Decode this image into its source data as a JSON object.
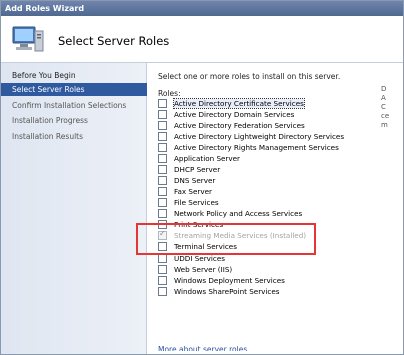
{
  "window": {
    "title": "Add Roles Wizard"
  },
  "header": {
    "title": "Select Server Roles",
    "icon": "server-computer-icon"
  },
  "sidebar": {
    "items": [
      {
        "label": "Before You Begin",
        "state": "normal"
      },
      {
        "label": "Select Server Roles",
        "state": "active"
      },
      {
        "label": "Confirm Installation Selections",
        "state": "inactive"
      },
      {
        "label": "Installation Progress",
        "state": "inactive"
      },
      {
        "label": "Installation Results",
        "state": "inactive"
      }
    ]
  },
  "main": {
    "instruction": "Select one or more roles to install on this server.",
    "roles_label": "Roles:",
    "roles": [
      {
        "label": "Active Directory Certificate Services",
        "checked": false,
        "disabled": false,
        "focused": true
      },
      {
        "label": "Active Directory Domain Services",
        "checked": false,
        "disabled": false
      },
      {
        "label": "Active Directory Federation Services",
        "checked": false,
        "disabled": false
      },
      {
        "label": "Active Directory Lightweight Directory Services",
        "checked": false,
        "disabled": false
      },
      {
        "label": "Active Directory Rights Management Services",
        "checked": false,
        "disabled": false
      },
      {
        "label": "Application Server",
        "checked": false,
        "disabled": false
      },
      {
        "label": "DHCP Server",
        "checked": false,
        "disabled": false
      },
      {
        "label": "DNS Server",
        "checked": false,
        "disabled": false
      },
      {
        "label": "Fax Server",
        "checked": false,
        "disabled": false
      },
      {
        "label": "File Services",
        "checked": false,
        "disabled": false
      },
      {
        "label": "Network Policy and Access Services",
        "checked": false,
        "disabled": false
      },
      {
        "label": "Print Services",
        "checked": false,
        "disabled": false
      },
      {
        "label": "Streaming Media Services  (Installed)",
        "checked": true,
        "disabled": true
      },
      {
        "label": "Terminal Services",
        "checked": false,
        "disabled": false
      },
      {
        "label": "UDDI Services",
        "checked": false,
        "disabled": false
      },
      {
        "label": "Web Server (IIS)",
        "checked": false,
        "disabled": false
      },
      {
        "label": "Windows Deployment Services",
        "checked": false,
        "disabled": false
      },
      {
        "label": "Windows SharePoint Services",
        "checked": false,
        "disabled": false
      }
    ],
    "more_link": "More about server roles"
  },
  "right_strip": [
    "D",
    "A",
    "C",
    "ce",
    "m"
  ],
  "colors": {
    "highlight_box": "#e53535",
    "active_nav": "#2f5a9f"
  }
}
